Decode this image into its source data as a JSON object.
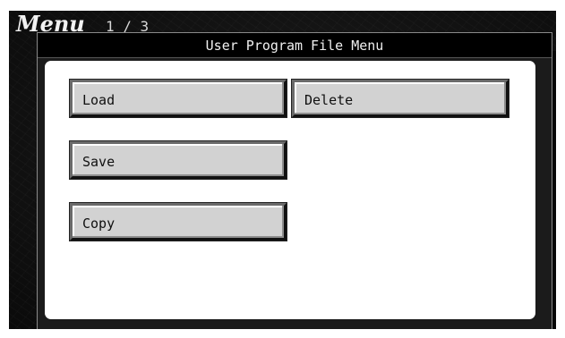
{
  "header": {
    "menu_label": "Menu",
    "page_indicator": "1 / 3"
  },
  "dialog": {
    "title": "User Program File Menu",
    "buttons": {
      "load": "Load",
      "delete": "Delete",
      "save": "Save",
      "copy": "Copy"
    }
  },
  "colors": {
    "background": "#151515",
    "dialog_titlebar": "#000000",
    "dialog_body": "#ffffff",
    "button_face": "#d2d2d2",
    "button_text": "#101010"
  }
}
